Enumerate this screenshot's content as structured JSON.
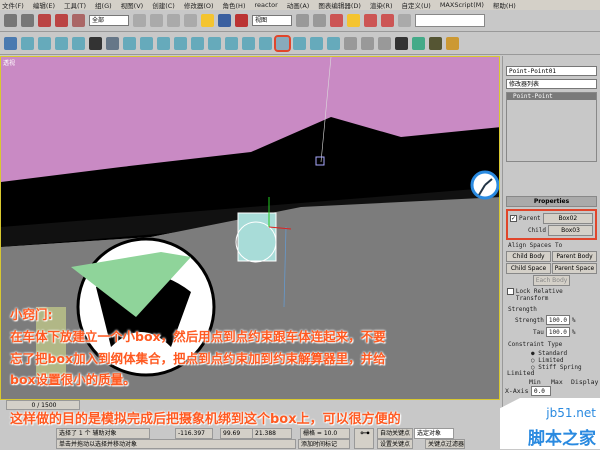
{
  "menu": [
    "文件(F)",
    "编辑(E)",
    "工具(T)",
    "组(G)",
    "视图(V)",
    "创建(C)",
    "修改器(O)",
    "角色(H)",
    "reactor",
    "动画(A)",
    "图表编辑器(D)",
    "渲染(R)",
    "自定义(U)",
    "MAXScript(M)",
    "帮助(H)"
  ],
  "toolbar": {
    "selection_filter": "全部",
    "reference_coord": "视图"
  },
  "viewport": {
    "label": "透视"
  },
  "panel": {
    "object_name": "Point-Point01",
    "modifier_list": "修改器列表",
    "stack_item": "Point-Point",
    "properties_title": "Properties",
    "parent_label": "Parent",
    "parent_value": "Box02",
    "child_label": "Child",
    "child_value": "Box03",
    "align_title": "Align Spaces To",
    "child_body": "Child Body",
    "parent_body": "Parent Body",
    "child_space": "Child Space",
    "parent_space": "Parent Space",
    "each_body": "Each Body",
    "lock_relative": "Lock Relative Transform",
    "strength_title": "Strength",
    "strength_label": "Strength",
    "strength_value": "100.0",
    "tau_label": "Tau",
    "tau_value": "100.0",
    "pct": "%",
    "constraint_title": "Constraint Type",
    "standard": "Standard",
    "limited": "Limited",
    "stiff_spring": "Stiff Spring",
    "limited_title": "Limited",
    "min": "Min",
    "max": "Max",
    "display": "Display",
    "xaxis": "X-Axis",
    "xmin": "0.0"
  },
  "notes": {
    "title": "小窍门:",
    "line1": "在车体下放建立一个小box，然后用点到点约束跟车体连起来，不要",
    "line2": "忘了把box加入到纲体集合，把点到点约束加到约束解算器里，并给",
    "line3": "box设置很小的质量。",
    "line4": "这样做的目的是模拟完成后把摄象机绑到这个box上，可以很方便的"
  },
  "status": {
    "frame": "0 / 1500",
    "selected": "选择了 1 个 辅助对象",
    "x": "-116.397",
    "y": "99.69",
    "z": "21.388",
    "grid": "栅格 = 10.0",
    "prompt": "单击并拖动以选择并移动对象",
    "add_tag": "添加时间标记",
    "auto_key": "自动关键点",
    "selected_obj": "选定对象",
    "set_key": "设置关键点",
    "key_filter": "关键点过滤器"
  },
  "watermark": {
    "site": "jb51.net",
    "name": "脚本之家"
  }
}
